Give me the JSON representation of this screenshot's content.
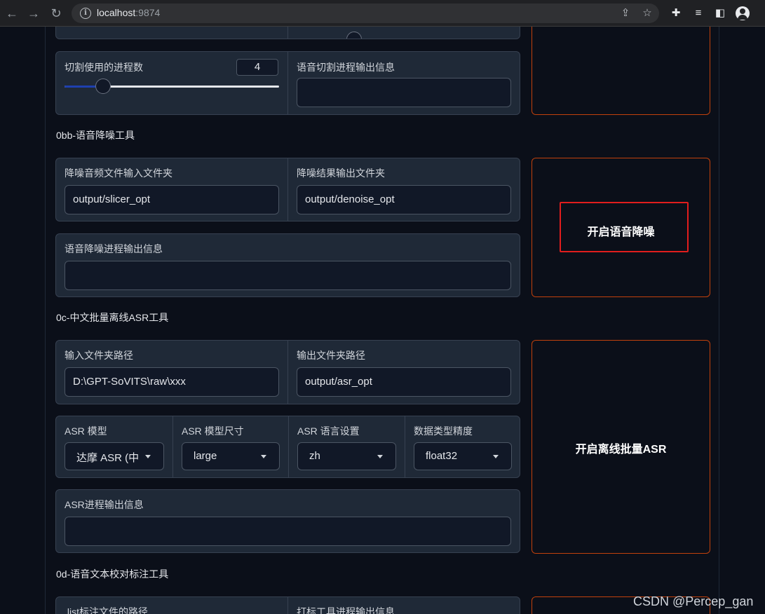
{
  "browser": {
    "url_host": "localhost",
    "url_port": ":9874"
  },
  "slicer": {
    "processes_label": "切割使用的进程数",
    "processes_value": "4",
    "processes_fraction": 0.18,
    "output_info_label": "语音切割进程输出信息"
  },
  "denoise": {
    "section_title": "0bb-语音降噪工具",
    "input_label": "降噪音频文件输入文件夹",
    "input_value": "output/slicer_opt",
    "output_label": "降噪结果输出文件夹",
    "output_value": "output/denoise_opt",
    "info_label": "语音降噪进程输出信息",
    "button_label": "开启语音降噪"
  },
  "asr": {
    "section_title": "0c-中文批量离线ASR工具",
    "input_label": "输入文件夹路径",
    "input_value": "D:\\GPT-SoVITS\\raw\\xxx",
    "output_label": "输出文件夹路径",
    "output_value": "output/asr_opt",
    "model_label": "ASR 模型",
    "model_value": "达摩 ASR (中",
    "size_label": "ASR 模型尺寸",
    "size_value": "large",
    "lang_label": "ASR 语言设置",
    "lang_value": "zh",
    "precision_label": "数据类型精度",
    "precision_value": "float32",
    "info_label": "ASR进程输出信息",
    "button_label": "开启离线批量ASR"
  },
  "proofread": {
    "section_title": "0d-语音文本校对标注工具",
    "list_label": ".list标注文件的路径",
    "info_label": "打标工具进程输出信息"
  },
  "watermark": "CSDN @Percep_gan",
  "colors": {
    "background": "#0b0f19",
    "panel": "#1f2937",
    "button_border": "#c2410c",
    "highlight": "#e11d1d",
    "slider_fill": "#1e40af"
  }
}
